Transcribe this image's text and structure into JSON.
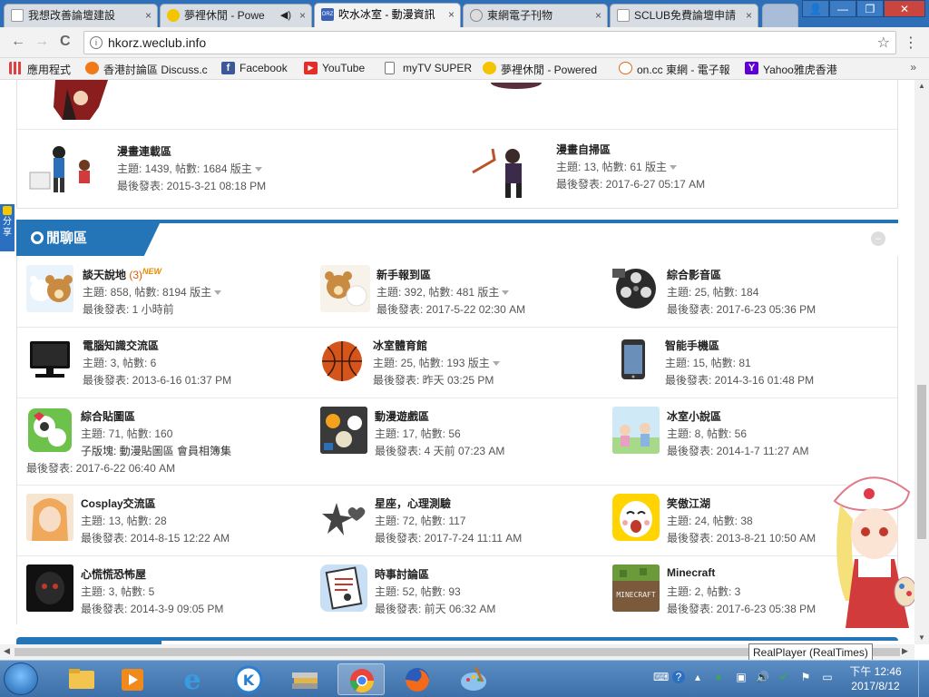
{
  "browser": {
    "tabs": [
      {
        "title": "我想改善論壇建設",
        "active": false,
        "favicon_color": "#ffffff"
      },
      {
        "title": "夢裡休閒 - Powe",
        "active": false,
        "favicon_color": "#f4c400",
        "audio": true
      },
      {
        "title": "吹水冰室 - 動漫資訊",
        "active": true,
        "favicon_color": "#3a63b8",
        "favicon_label": "ORZ"
      },
      {
        "title": "東網電子刊物",
        "active": false,
        "favicon_color": "#d9d9d9"
      },
      {
        "title": "SCLUB免費論壇申請",
        "active": false,
        "favicon_color": "#ffffff"
      }
    ],
    "tab_close": "×",
    "window_controls": {
      "user": "👤",
      "minimize": "—",
      "maximize": "❐",
      "close": "✕"
    },
    "back": "←",
    "forward": "→",
    "reload": "C",
    "url": "hkorz.weclub.info",
    "info_icon": "i",
    "star": "☆",
    "menu": "⋮",
    "bookmarks": [
      {
        "label": "應用程式",
        "icon_color": "#e04040"
      },
      {
        "label": "香港討論區 Discuss.c",
        "icon_color": "#f07a1a"
      },
      {
        "label": "Facebook",
        "icon_color": "#3b5998"
      },
      {
        "label": "YouTube",
        "icon_color": "#e52d27"
      },
      {
        "label": "myTV SUPER",
        "icon_color": "#ffffff"
      },
      {
        "label": "夢裡休閒 - Powered",
        "icon_color": "#f4c400"
      },
      {
        "label": "on.cc 東網 - 電子報",
        "icon_color": "#d96a1e"
      },
      {
        "label": "Yahoo雅虎香港",
        "icon_color": "#5f01d1"
      }
    ],
    "bookmarks_more": "»"
  },
  "page": {
    "share_label": "分享",
    "top_forums": [
      {
        "name": "漫畫連載區",
        "stats": "主題: 1439, 帖數: 1684",
        "moderator": "版主",
        "last_post": "最後發表: 2015-3-21 08:18 PM"
      },
      {
        "name": "漫畫自掃區",
        "stats": "主題: 13, 帖數: 61",
        "moderator": "版主",
        "last_post": "最後發表: 2017-6-27 05:17 AM"
      }
    ],
    "section_title": "閒聊區",
    "collapse_icon": "−",
    "forums": [
      {
        "name": "談天說地",
        "count": "(3)",
        "new": "NEW",
        "stats": "主題: 858, 帖數: 8194",
        "moderator": "版主",
        "last_post": "最後發表: 1 小時前",
        "icon_color": "#e9c27a"
      },
      {
        "name": "新手報到區",
        "stats": "主題: 392, 帖數: 481",
        "moderator": "版主",
        "last_post": "最後發表: 2017-5-22 02:30 AM",
        "icon_color": "#e9c27a"
      },
      {
        "name": "綜合影音區",
        "stats": "主題: 25, 帖數: 184",
        "last_post": "最後發表: 2017-6-23 05:36 PM",
        "icon_color": "#2b2b2b"
      },
      {
        "name": "電腦知識交流區",
        "stats": "主題: 3, 帖數: 6",
        "last_post": "最後發表: 2013-6-16 01:37 PM",
        "icon_color": "#1a1a1a"
      },
      {
        "name": "冰室體育館",
        "stats": "主題: 25, 帖數: 193",
        "moderator": "版主",
        "last_post": "最後發表: 昨天 03:25 PM",
        "icon_color": "#d4541c"
      },
      {
        "name": "智能手機區",
        "stats": "主題: 15, 帖數: 81",
        "last_post": "最後發表: 2014-3-16 01:48 PM",
        "icon_color": "#333333"
      },
      {
        "name": "綜合貼圖區",
        "stats": "主題: 71, 帖數: 160",
        "sub": "子版塊: 動漫貼圖區 會員相簿集",
        "last_post": "最後發表: 2017-6-22 06:40 AM",
        "icon_color": "#6cc24a"
      },
      {
        "name": "動漫遊戲區",
        "stats": "主題: 17, 帖數: 56",
        "last_post": "最後發表: 4 天前 07:23 AM",
        "icon_color": "#4a4a4a"
      },
      {
        "name": "冰室小說區",
        "stats": "主題: 8, 帖數: 56",
        "last_post": "最後發表: 2014-1-7 11:27 AM",
        "icon_color": "#a8d88a"
      },
      {
        "name": "Cosplay交流區",
        "stats": "主題: 13, 帖數: 28",
        "last_post": "最後發表: 2014-8-15 12:22 AM",
        "icon_color": "#f0a85a"
      },
      {
        "name": "星座，心理測驗",
        "stats": "主題: 72, 帖數: 117",
        "last_post": "最後發表: 2017-7-24 11:11 AM",
        "icon_color": "#ffffff"
      },
      {
        "name": "笑傲江湖",
        "stats": "主題: 24, 帖數: 38",
        "last_post": "最後發表: 2013-8-21 10:50 AM",
        "icon_color": "#ffd400"
      },
      {
        "name": "心慌慌恐怖屋",
        "stats": "主題: 3, 帖數: 5",
        "last_post": "最後發表: 2014-3-9 09:05 PM",
        "icon_color": "#111111"
      },
      {
        "name": "時事討論區",
        "stats": "主題: 52, 帖數: 93",
        "last_post": "最後發表: 前天 06:32 AM",
        "icon_color": "#c8dff5"
      },
      {
        "name": "Minecraft",
        "stats": "主題: 2, 帖數: 3",
        "last_post": "最後發表: 2017-6-23 05:38 PM",
        "icon_color": "#6b9a3a"
      }
    ]
  },
  "tooltip": "RealPlayer (RealTimes)",
  "taskbar": {
    "apps": [
      {
        "name": "explorer",
        "color": "#f3c54f"
      },
      {
        "name": "media",
        "color": "#f08a1c"
      },
      {
        "name": "ie",
        "color": "#3a9be0"
      },
      {
        "name": "k-app",
        "color": "#2a7fd0"
      },
      {
        "name": "stack",
        "color": "#c9c9c9"
      },
      {
        "name": "chrome",
        "color": "#e8453c",
        "active": true
      },
      {
        "name": "firefox",
        "color": "#f26a1b"
      },
      {
        "name": "paint",
        "color": "#8ec2ee"
      }
    ],
    "tray": [
      "⌨",
      "?",
      "▴",
      "●",
      "▣",
      "🔊",
      "✔",
      "⚑",
      "▭"
    ],
    "time": "下午 12:46",
    "date": "2017/8/12"
  }
}
